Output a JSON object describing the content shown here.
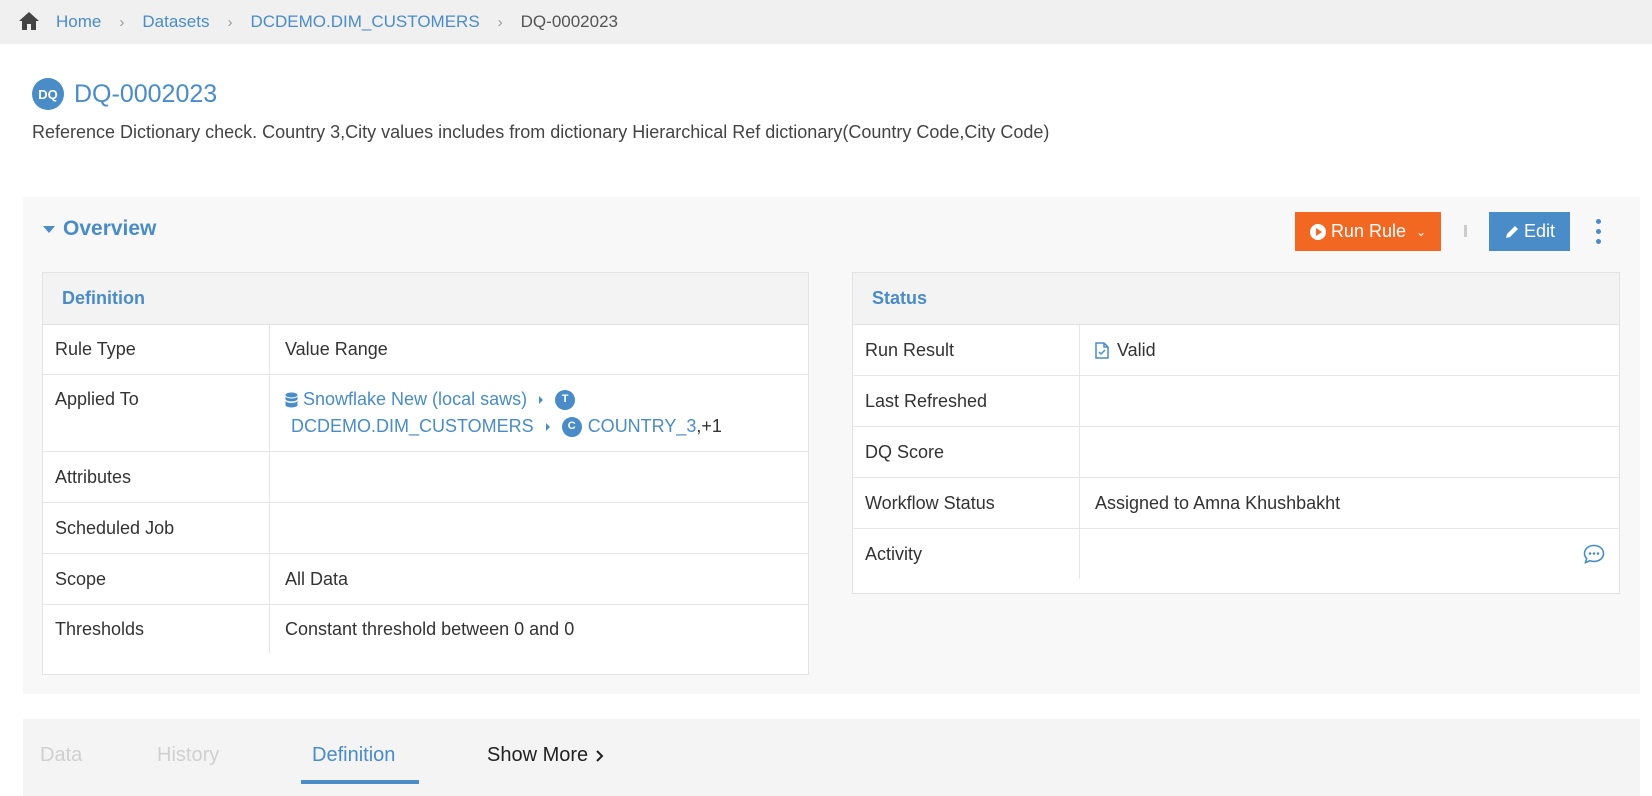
{
  "breadcrumb": {
    "items": [
      "Home",
      "Datasets",
      "DCDEMO.DIM_CUSTOMERS"
    ],
    "current": "DQ-0002023"
  },
  "header": {
    "badge": "DQ",
    "title": "DQ-0002023",
    "description": "Reference Dictionary check. Country 3,City values includes from dictionary Hierarchical Ref dictionary(Country Code,City Code)"
  },
  "overview": {
    "title": "Overview",
    "run_label": "Run Rule",
    "edit_label": "Edit"
  },
  "definition": {
    "title": "Definition",
    "rule_type_label": "Rule Type",
    "rule_type_value": "Value Range",
    "applied_to_label": "Applied To",
    "applied_source": "Snowflake New (local saws)",
    "applied_table_badge": "T",
    "applied_table": "DCDEMO.DIM_CUSTOMERS",
    "applied_column_badge": "C",
    "applied_column": "COUNTRY_3",
    "applied_extra": ",+1",
    "attributes_label": "Attributes",
    "scheduled_job_label": "Scheduled Job",
    "scope_label": "Scope",
    "scope_value": "All Data",
    "thresholds_label": "Thresholds",
    "thresholds_value": "Constant threshold between 0 and 0"
  },
  "status": {
    "title": "Status",
    "run_result_label": "Run Result",
    "run_result_value": "Valid",
    "last_refreshed_label": "Last Refreshed",
    "dq_score_label": "DQ Score",
    "workflow_status_label": "Workflow Status",
    "workflow_status_value": "Assigned to Amna Khushbakht",
    "activity_label": "Activity"
  },
  "tabs": {
    "data": "Data",
    "history": "History",
    "definition": "Definition",
    "show_more": "Show More"
  },
  "colors": {
    "accent": "#4a8cc7",
    "run_button": "#f26722"
  }
}
